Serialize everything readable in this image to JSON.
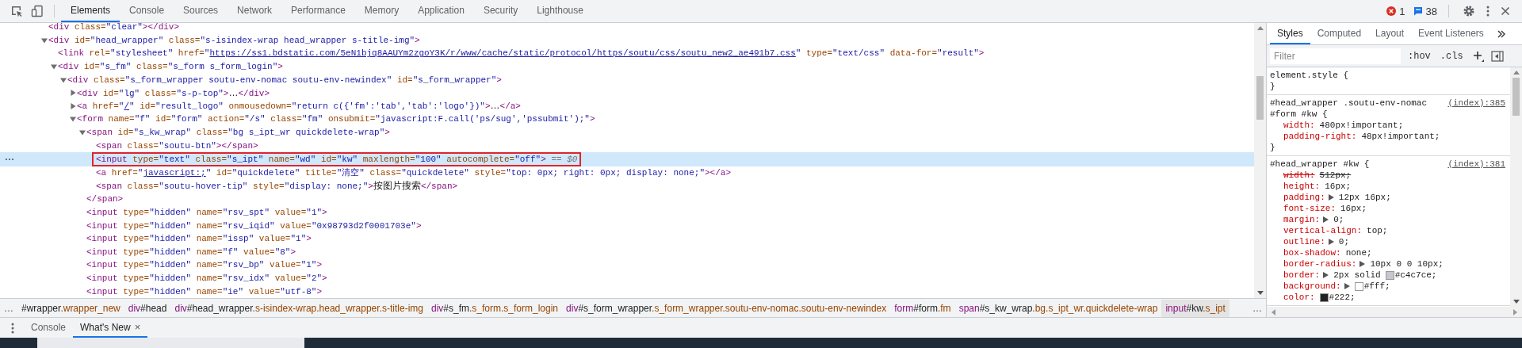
{
  "toolbar": {
    "tabs": [
      {
        "label": "Elements",
        "selected": true
      },
      {
        "label": "Console",
        "selected": false
      },
      {
        "label": "Sources",
        "selected": false
      },
      {
        "label": "Network",
        "selected": false
      },
      {
        "label": "Performance",
        "selected": false
      },
      {
        "label": "Memory",
        "selected": false
      },
      {
        "label": "Application",
        "selected": false
      },
      {
        "label": "Security",
        "selected": false
      },
      {
        "label": "Lighthouse",
        "selected": false
      }
    ],
    "errors": "1",
    "messages": "38"
  },
  "tree": {
    "nodes": [
      {
        "segs": [
          {
            "kind": "tag",
            "text": "<div"
          },
          {
            "kind": "attr",
            "text": " class="
          },
          {
            "kind": "value",
            "text": "\"clear\""
          },
          {
            "kind": "tag",
            "text": "></div>"
          }
        ],
        "selected": false,
        "outlined": false
      },
      {
        "segs": [
          {
            "kind": "tag",
            "text": "<div"
          },
          {
            "kind": "attr",
            "text": " id="
          },
          {
            "kind": "value",
            "text": "\"head_wrapper\""
          },
          {
            "kind": "attr",
            "text": " class="
          },
          {
            "kind": "value",
            "text": "\"s-isindex-wrap head_wrapper s-title-img\""
          },
          {
            "kind": "tag",
            "text": ">"
          }
        ],
        "expanded": true,
        "selected": false,
        "outlined": false,
        "children": [
          {
            "segs": [
              {
                "kind": "tag",
                "text": "<link"
              },
              {
                "kind": "attr",
                "text": " rel="
              },
              {
                "kind": "value",
                "text": "\"stylesheet\""
              },
              {
                "kind": "attr",
                "text": " href="
              },
              {
                "kind": "value",
                "text": "\""
              },
              {
                "kind": "link",
                "text": "https://ss1.bdstatic.com/5eN1bjq8AAUYm2zgoY3K/r/www/cache/static/protocol/https/soutu/css/soutu_new2_ae491b7.css"
              },
              {
                "kind": "value",
                "text": "\""
              },
              {
                "kind": "attr",
                "text": " type="
              },
              {
                "kind": "value",
                "text": "\"text/css\""
              },
              {
                "kind": "attr",
                "text": " data-for="
              },
              {
                "kind": "value",
                "text": "\"result\""
              },
              {
                "kind": "tag",
                "text": ">"
              }
            ],
            "selected": false,
            "outlined": false
          },
          {
            "segs": [
              {
                "kind": "tag",
                "text": "<div"
              },
              {
                "kind": "attr",
                "text": " id="
              },
              {
                "kind": "value",
                "text": "\"s_fm\""
              },
              {
                "kind": "attr",
                "text": " class="
              },
              {
                "kind": "value",
                "text": "\"s_form s_form_login\""
              },
              {
                "kind": "tag",
                "text": ">"
              }
            ],
            "expanded": true,
            "selected": false,
            "outlined": false,
            "children": [
              {
                "segs": [
                  {
                    "kind": "tag",
                    "text": "<div"
                  },
                  {
                    "kind": "attr",
                    "text": " class="
                  },
                  {
                    "kind": "value",
                    "text": "\"s_form_wrapper soutu-env-nomac soutu-env-newindex\""
                  },
                  {
                    "kind": "attr",
                    "text": " id="
                  },
                  {
                    "kind": "value",
                    "text": "\"s_form_wrapper\""
                  },
                  {
                    "kind": "tag",
                    "text": ">"
                  }
                ],
                "expanded": true,
                "selected": false,
                "outlined": false,
                "children": [
                  {
                    "segs": [
                      {
                        "kind": "tag",
                        "text": "<div"
                      },
                      {
                        "kind": "attr",
                        "text": " id="
                      },
                      {
                        "kind": "value",
                        "text": "\"lg\""
                      },
                      {
                        "kind": "attr",
                        "text": " class="
                      },
                      {
                        "kind": "value",
                        "text": "\"s-p-top\""
                      },
                      {
                        "kind": "tag",
                        "text": ">"
                      },
                      {
                        "kind": "text",
                        "text": "…"
                      },
                      {
                        "kind": "tag",
                        "text": "</div>"
                      }
                    ],
                    "expanded": false,
                    "selected": false,
                    "outlined": false
                  },
                  {
                    "segs": [
                      {
                        "kind": "tag",
                        "text": "<a"
                      },
                      {
                        "kind": "attr",
                        "text": " href="
                      },
                      {
                        "kind": "value",
                        "text": "\""
                      },
                      {
                        "kind": "link",
                        "text": "/"
                      },
                      {
                        "kind": "value",
                        "text": "\""
                      },
                      {
                        "kind": "attr",
                        "text": " id="
                      },
                      {
                        "kind": "value",
                        "text": "\"result_logo\""
                      },
                      {
                        "kind": "attr",
                        "text": " onmousedown="
                      },
                      {
                        "kind": "value",
                        "text": "\"return c({'fm':'tab','tab':'logo'})\""
                      },
                      {
                        "kind": "tag",
                        "text": ">"
                      },
                      {
                        "kind": "text",
                        "text": "…"
                      },
                      {
                        "kind": "tag",
                        "text": "</a>"
                      }
                    ],
                    "expanded": false,
                    "selected": false,
                    "outlined": false
                  },
                  {
                    "segs": [
                      {
                        "kind": "tag",
                        "text": "<form"
                      },
                      {
                        "kind": "attr",
                        "text": " name="
                      },
                      {
                        "kind": "value",
                        "text": "\"f\""
                      },
                      {
                        "kind": "attr",
                        "text": " id="
                      },
                      {
                        "kind": "value",
                        "text": "\"form\""
                      },
                      {
                        "kind": "attr",
                        "text": " action="
                      },
                      {
                        "kind": "value",
                        "text": "\"/s\""
                      },
                      {
                        "kind": "attr",
                        "text": " class="
                      },
                      {
                        "kind": "value",
                        "text": "\"fm\""
                      },
                      {
                        "kind": "attr",
                        "text": " onsubmit="
                      },
                      {
                        "kind": "value",
                        "text": "\"javascript:F.call('ps/sug','pssubmit');\""
                      },
                      {
                        "kind": "tag",
                        "text": ">"
                      }
                    ],
                    "expanded": true,
                    "selected": false,
                    "outlined": false,
                    "children": [
                      {
                        "segs": [
                          {
                            "kind": "tag",
                            "text": "<span"
                          },
                          {
                            "kind": "attr",
                            "text": " id="
                          },
                          {
                            "kind": "value",
                            "text": "\"s_kw_wrap\""
                          },
                          {
                            "kind": "attr",
                            "text": " class="
                          },
                          {
                            "kind": "value",
                            "text": "\"bg s_ipt_wr quickdelete-wrap\""
                          },
                          {
                            "kind": "tag",
                            "text": ">"
                          }
                        ],
                        "expanded": true,
                        "selected": false,
                        "outlined": false,
                        "close": [
                          {
                            "kind": "tag",
                            "text": "</span>"
                          }
                        ],
                        "children": [
                          {
                            "segs": [
                              {
                                "kind": "tag",
                                "text": "<span"
                              },
                              {
                                "kind": "attr",
                                "text": " class="
                              },
                              {
                                "kind": "value",
                                "text": "\"soutu-btn\""
                              },
                              {
                                "kind": "tag",
                                "text": "></span>"
                              }
                            ],
                            "selected": false,
                            "outlined": false
                          },
                          {
                            "segs": [
                              {
                                "kind": "tag",
                                "text": "<input"
                              },
                              {
                                "kind": "attr",
                                "text": " type="
                              },
                              {
                                "kind": "value",
                                "text": "\"text\""
                              },
                              {
                                "kind": "attr",
                                "text": " class="
                              },
                              {
                                "kind": "value",
                                "text": "\"s_ipt\""
                              },
                              {
                                "kind": "attr",
                                "text": " name="
                              },
                              {
                                "kind": "value",
                                "text": "\"wd\""
                              },
                              {
                                "kind": "attr",
                                "text": " id="
                              },
                              {
                                "kind": "value",
                                "text": "\"kw\""
                              },
                              {
                                "kind": "attr",
                                "text": " maxlength="
                              },
                              {
                                "kind": "value",
                                "text": "\"100\""
                              },
                              {
                                "kind": "attr",
                                "text": " autocomplete="
                              },
                              {
                                "kind": "value",
                                "text": "\"off\""
                              },
                              {
                                "kind": "tag",
                                "text": ">"
                              },
                              {
                                "kind": "ref",
                                "text": " == $0"
                              }
                            ],
                            "selected": true,
                            "outlined": true
                          },
                          {
                            "segs": [
                              {
                                "kind": "tag",
                                "text": "<a"
                              },
                              {
                                "kind": "attr",
                                "text": " href="
                              },
                              {
                                "kind": "value",
                                "text": "\""
                              },
                              {
                                "kind": "link",
                                "text": "javascript:;"
                              },
                              {
                                "kind": "value",
                                "text": "\""
                              },
                              {
                                "kind": "attr",
                                "text": " id="
                              },
                              {
                                "kind": "value",
                                "text": "\"quickdelete\""
                              },
                              {
                                "kind": "attr",
                                "text": " title="
                              },
                              {
                                "kind": "value",
                                "text": "\"清空\""
                              },
                              {
                                "kind": "attr",
                                "text": " class="
                              },
                              {
                                "kind": "value",
                                "text": "\"quickdelete\""
                              },
                              {
                                "kind": "attr",
                                "text": " style="
                              },
                              {
                                "kind": "value",
                                "text": "\"top: 0px; right: 0px; display: none;\""
                              },
                              {
                                "kind": "tag",
                                "text": "></a>"
                              }
                            ],
                            "selected": false,
                            "outlined": false
                          },
                          {
                            "segs": [
                              {
                                "kind": "tag",
                                "text": "<span"
                              },
                              {
                                "kind": "attr",
                                "text": " class="
                              },
                              {
                                "kind": "value",
                                "text": "\"soutu-hover-tip\""
                              },
                              {
                                "kind": "attr",
                                "text": " style="
                              },
                              {
                                "kind": "value",
                                "text": "\"display: none;\""
                              },
                              {
                                "kind": "tag",
                                "text": ">"
                              },
                              {
                                "kind": "text",
                                "text": "按图片搜索"
                              },
                              {
                                "kind": "tag",
                                "text": "</span>"
                              }
                            ],
                            "selected": false,
                            "outlined": false
                          }
                        ]
                      },
                      {
                        "segs": [
                          {
                            "kind": "tag",
                            "text": "<input"
                          },
                          {
                            "kind": "attr",
                            "text": " type="
                          },
                          {
                            "kind": "value",
                            "text": "\"hidden\""
                          },
                          {
                            "kind": "attr",
                            "text": " name="
                          },
                          {
                            "kind": "value",
                            "text": "\"rsv_spt\""
                          },
                          {
                            "kind": "attr",
                            "text": " value="
                          },
                          {
                            "kind": "value",
                            "text": "\"1\""
                          },
                          {
                            "kind": "tag",
                            "text": ">"
                          }
                        ],
                        "selected": false,
                        "outlined": false
                      },
                      {
                        "segs": [
                          {
                            "kind": "tag",
                            "text": "<input"
                          },
                          {
                            "kind": "attr",
                            "text": " type="
                          },
                          {
                            "kind": "value",
                            "text": "\"hidden\""
                          },
                          {
                            "kind": "attr",
                            "text": " name="
                          },
                          {
                            "kind": "value",
                            "text": "\"rsv_iqid\""
                          },
                          {
                            "kind": "attr",
                            "text": " value="
                          },
                          {
                            "kind": "value",
                            "text": "\"0x98793d2f0001703e\""
                          },
                          {
                            "kind": "tag",
                            "text": ">"
                          }
                        ],
                        "selected": false,
                        "outlined": false
                      },
                      {
                        "segs": [
                          {
                            "kind": "tag",
                            "text": "<input"
                          },
                          {
                            "kind": "attr",
                            "text": " type="
                          },
                          {
                            "kind": "value",
                            "text": "\"hidden\""
                          },
                          {
                            "kind": "attr",
                            "text": " name="
                          },
                          {
                            "kind": "value",
                            "text": "\"issp\""
                          },
                          {
                            "kind": "attr",
                            "text": " value="
                          },
                          {
                            "kind": "value",
                            "text": "\"1\""
                          },
                          {
                            "kind": "tag",
                            "text": ">"
                          }
                        ],
                        "selected": false,
                        "outlined": false
                      },
                      {
                        "segs": [
                          {
                            "kind": "tag",
                            "text": "<input"
                          },
                          {
                            "kind": "attr",
                            "text": " type="
                          },
                          {
                            "kind": "value",
                            "text": "\"hidden\""
                          },
                          {
                            "kind": "attr",
                            "text": " name="
                          },
                          {
                            "kind": "value",
                            "text": "\"f\""
                          },
                          {
                            "kind": "attr",
                            "text": " value="
                          },
                          {
                            "kind": "value",
                            "text": "\"8\""
                          },
                          {
                            "kind": "tag",
                            "text": ">"
                          }
                        ],
                        "selected": false,
                        "outlined": false
                      },
                      {
                        "segs": [
                          {
                            "kind": "tag",
                            "text": "<input"
                          },
                          {
                            "kind": "attr",
                            "text": " type="
                          },
                          {
                            "kind": "value",
                            "text": "\"hidden\""
                          },
                          {
                            "kind": "attr",
                            "text": " name="
                          },
                          {
                            "kind": "value",
                            "text": "\"rsv_bp\""
                          },
                          {
                            "kind": "attr",
                            "text": " value="
                          },
                          {
                            "kind": "value",
                            "text": "\"1\""
                          },
                          {
                            "kind": "tag",
                            "text": ">"
                          }
                        ],
                        "selected": false,
                        "outlined": false
                      },
                      {
                        "segs": [
                          {
                            "kind": "tag",
                            "text": "<input"
                          },
                          {
                            "kind": "attr",
                            "text": " type="
                          },
                          {
                            "kind": "value",
                            "text": "\"hidden\""
                          },
                          {
                            "kind": "attr",
                            "text": " name="
                          },
                          {
                            "kind": "value",
                            "text": "\"rsv_idx\""
                          },
                          {
                            "kind": "attr",
                            "text": " value="
                          },
                          {
                            "kind": "value",
                            "text": "\"2\""
                          },
                          {
                            "kind": "tag",
                            "text": ">"
                          }
                        ],
                        "selected": false,
                        "outlined": false
                      },
                      {
                        "segs": [
                          {
                            "kind": "tag",
                            "text": "<input"
                          },
                          {
                            "kind": "attr",
                            "text": " type="
                          },
                          {
                            "kind": "value",
                            "text": "\"hidden\""
                          },
                          {
                            "kind": "attr",
                            "text": " name="
                          },
                          {
                            "kind": "value",
                            "text": "\"ie\""
                          },
                          {
                            "kind": "attr",
                            "text": " value="
                          },
                          {
                            "kind": "value",
                            "text": "\"utf-8\""
                          },
                          {
                            "kind": "tag",
                            "text": ">"
                          }
                        ],
                        "selected": false,
                        "outlined": false
                      }
                    ]
                  }
                ]
              }
            ]
          }
        ]
      }
    ]
  },
  "breadcrumbs": {
    "overflow_left": "…",
    "overflow_right": "…",
    "items": [
      {
        "id": "#wrapper",
        "classes": ".wrapper_new",
        "selected": false
      },
      {
        "tag": "div",
        "id": "#head",
        "selected": false
      },
      {
        "tag": "div",
        "id": "#head_wrapper",
        "classes": ".s-isindex-wrap.head_wrapper.s-title-img",
        "selected": false
      },
      {
        "tag": "div",
        "id": "#s_fm",
        "classes": ".s_form.s_form_login",
        "selected": false
      },
      {
        "tag": "div",
        "id": "#s_form_wrapper",
        "classes": ".s_form_wrapper.soutu-env-nomac.soutu-env-newindex",
        "selected": false
      },
      {
        "tag": "form",
        "id": "#form",
        "classes": ".fm",
        "selected": false
      },
      {
        "tag": "span",
        "id": "#s_kw_wrap",
        "classes": ".bg.s_ipt_wr.quickdelete-wrap",
        "selected": false
      },
      {
        "tag": "input",
        "id": "#kw",
        "classes": ".s_ipt",
        "selected": true
      }
    ]
  },
  "styles": {
    "tabs": [
      {
        "label": "Styles",
        "selected": true
      },
      {
        "label": "Computed",
        "selected": false
      },
      {
        "label": "Layout",
        "selected": false
      },
      {
        "label": "Event Listeners",
        "selected": false
      }
    ],
    "filter": {
      "placeholder": "Filter"
    },
    "hov": ":hov",
    "cls": ".cls",
    "rules": [
      {
        "selector_lines": [
          "element.style {"
        ],
        "close": "}"
      },
      {
        "selector_lines": [
          "#head_wrapper .soutu-env-nomac",
          "#form #kw {"
        ],
        "source": "(index):385",
        "close": "}",
        "props": [
          {
            "name": "width:",
            "value": "480px!important;",
            "overridden": false,
            "expandable": false
          },
          {
            "name": "padding-right:",
            "value": "48px!important;",
            "overridden": false,
            "expandable": false
          }
        ]
      },
      {
        "selector_lines": [
          "#head_wrapper #kw {"
        ],
        "source": "(index):381",
        "props": [
          {
            "name": "width:",
            "value": "512px;",
            "overridden": true,
            "expandable": false
          },
          {
            "name": "height:",
            "value": "16px;",
            "overridden": false,
            "expandable": false
          },
          {
            "name": "padding:",
            "value": "12px 16px;",
            "overridden": false,
            "expandable": true
          },
          {
            "name": "font-size:",
            "value": "16px;",
            "overridden": false,
            "expandable": false
          },
          {
            "name": "margin:",
            "value": "0;",
            "overridden": false,
            "expandable": true
          },
          {
            "name": "vertical-align:",
            "value": "top;",
            "overridden": false,
            "expandable": false
          },
          {
            "name": "outline:",
            "value": "0;",
            "overridden": false,
            "expandable": true
          },
          {
            "name": "box-shadow:",
            "value": "none;",
            "overridden": false,
            "expandable": false
          },
          {
            "name": "border-radius:",
            "value": "10px 0 0 10px;",
            "overridden": false,
            "expandable": true
          },
          {
            "name": "border:",
            "value": "2px solid",
            "color": "#c4c7ce",
            "value2": "#c4c7ce;",
            "overridden": false,
            "expandable": true
          },
          {
            "name": "background:",
            "color": "#ffffff",
            "value2": "#fff;",
            "overridden": false,
            "expandable": true
          },
          {
            "name": "color:",
            "color": "#222222",
            "value2": "#222;",
            "overridden": false,
            "expandable": false
          }
        ]
      }
    ]
  },
  "drawer": {
    "tabs": [
      {
        "label": "Console",
        "selected": false
      },
      {
        "label": "What's New",
        "selected": true,
        "close": "×"
      }
    ]
  }
}
